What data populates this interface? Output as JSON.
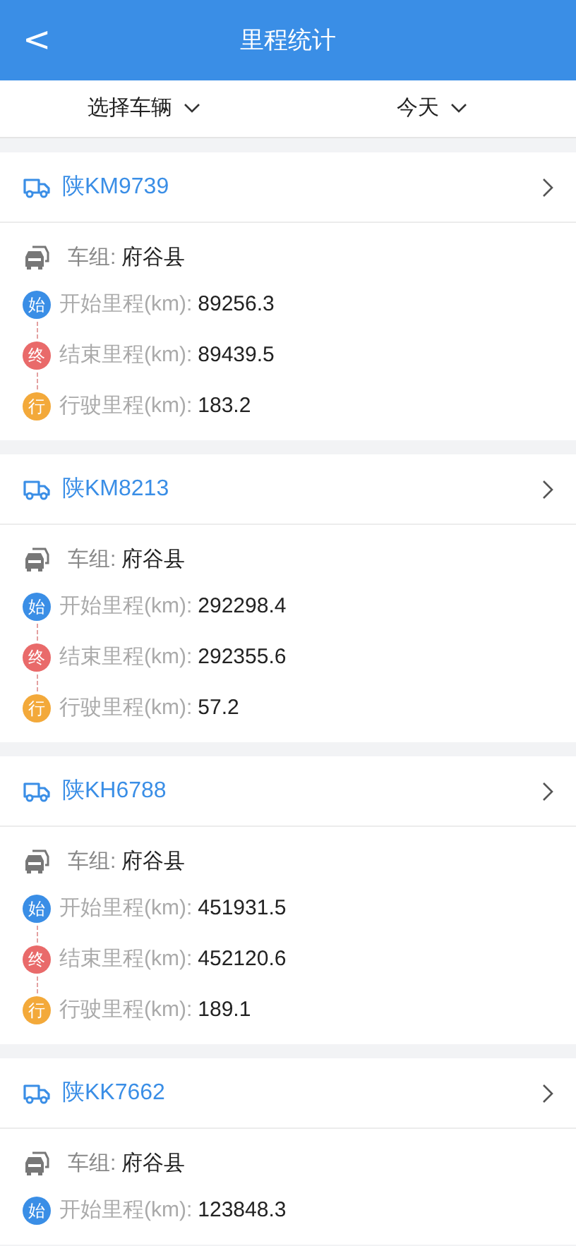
{
  "header": {
    "back": "<",
    "title": "里程统计"
  },
  "filters": [
    {
      "label": "选择车辆"
    },
    {
      "label": "今天"
    }
  ],
  "vehicles": [
    {
      "plate": "陕KM9739",
      "group_label": "车组:",
      "group": "府谷县",
      "rows": [
        {
          "kind": "start",
          "badge": "始",
          "label": "开始里程(km):",
          "value": "89256.3"
        },
        {
          "kind": "end",
          "badge": "终",
          "label": "结束里程(km):",
          "value": "89439.5"
        },
        {
          "kind": "travel",
          "badge": "行",
          "label": "行驶里程(km):",
          "value": "183.2"
        }
      ]
    },
    {
      "plate": "陕KM8213",
      "group_label": "车组:",
      "group": "府谷县",
      "rows": [
        {
          "kind": "start",
          "badge": "始",
          "label": "开始里程(km):",
          "value": "292298.4"
        },
        {
          "kind": "end",
          "badge": "终",
          "label": "结束里程(km):",
          "value": "292355.6"
        },
        {
          "kind": "travel",
          "badge": "行",
          "label": "行驶里程(km):",
          "value": "57.2"
        }
      ]
    },
    {
      "plate": "陕KH6788",
      "group_label": "车组:",
      "group": "府谷县",
      "rows": [
        {
          "kind": "start",
          "badge": "始",
          "label": "开始里程(km):",
          "value": "451931.5"
        },
        {
          "kind": "end",
          "badge": "终",
          "label": "结束里程(km):",
          "value": "452120.6"
        },
        {
          "kind": "travel",
          "badge": "行",
          "label": "行驶里程(km):",
          "value": "189.1"
        }
      ]
    },
    {
      "plate": "陕KK7662",
      "group_label": "车组:",
      "group": "府谷县",
      "rows": [
        {
          "kind": "start",
          "badge": "始",
          "label": "开始里程(km):",
          "value": "123848.3"
        }
      ]
    }
  ]
}
